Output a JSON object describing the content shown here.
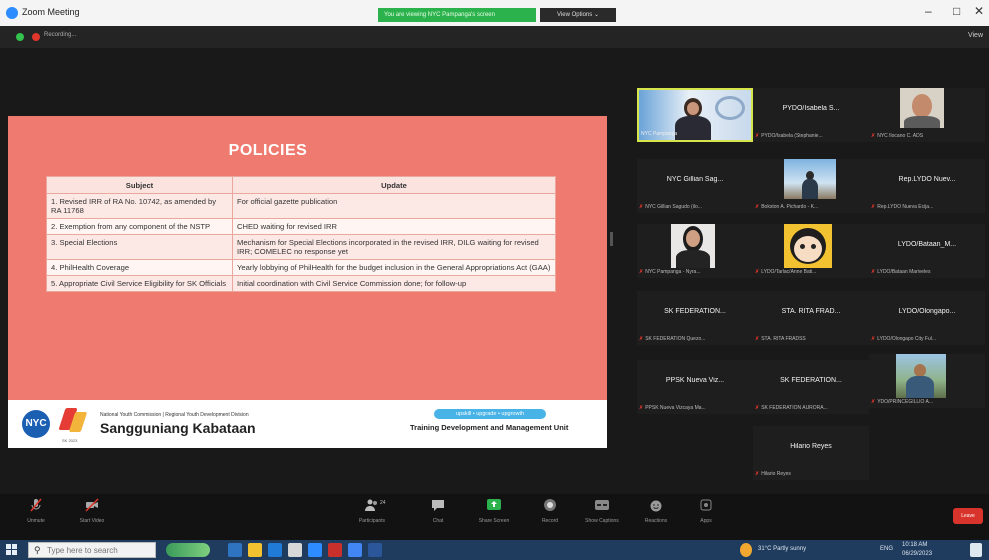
{
  "window": {
    "title": "Zoom Meeting",
    "share_banner": "You are viewing NYC Pampanga's screen",
    "view_options": "View Options ⌄",
    "minimize": "–",
    "maximize": "□",
    "close": "✕"
  },
  "status": {
    "recording": "Recording...",
    "view": "View"
  },
  "slide": {
    "title": "POLICIES",
    "table": {
      "headers": [
        "Subject",
        "Update"
      ],
      "rows": [
        {
          "subject": "1. Revised IRR of RA No. 10742, as amended by RA 11768",
          "update": "For official gazette publication"
        },
        {
          "subject": "2. Exemption from any component of the NSTP",
          "update": "CHED waiting for revised IRR"
        },
        {
          "subject": "3. Special Elections",
          "update": "Mechanism for Special Elections incorporated in the revised IRR, DILG waiting for revised IRR; COMELEC no response yet"
        },
        {
          "subject": "4. PhilHealth Coverage",
          "update": "Yearly lobbying of PhilHealth for the budget inclusion in the General Appropriations Act (GAA)"
        },
        {
          "subject": "5. Appropriate Civil Service Eligibility for SK Officials",
          "update": "Initial coordination with Civil Service Commission done; for follow-up"
        }
      ]
    },
    "footer": {
      "nyc_logo": "NYC",
      "sk_logo_sub": "SK 2023",
      "nyc_small": "National Youth Commission | Regional Youth Development Division",
      "sk_name": "Sangguniang Kabataan",
      "tagline": "upskill • upgrade • upgrowth",
      "unit": "Training Development and Management Unit"
    }
  },
  "participants": [
    {
      "display": "",
      "label": "NYC Pampanga",
      "muted": false,
      "video": true,
      "active": true
    },
    {
      "display": "PYDO/Isabela S...",
      "label": "PYDO/Isabela (Stephanie...",
      "muted": true,
      "video": false
    },
    {
      "display": "",
      "label": "NYC Ilocano C. ADS",
      "muted": true,
      "video": true
    },
    {
      "display": "NYC Gillian Sag...",
      "label": "NYC Gillian Sagudo (ilo...",
      "muted": true,
      "video": false
    },
    {
      "display": "",
      "label": "Bokston A. Pichardo - K...",
      "muted": true,
      "video": true
    },
    {
      "display": "Rep.LYDO Nuev...",
      "label": "Rep.LYDO Nueva Ecija...",
      "muted": true,
      "video": false
    },
    {
      "display": "",
      "label": "NYC Pampanga - Nyra...",
      "muted": true,
      "video": true
    },
    {
      "display": "",
      "label": "LYDO/Tarlac/Anne Bati...",
      "muted": true,
      "video": true
    },
    {
      "display": "LYDO/Bataan_M...",
      "label": "LYDO/Bataan Mariveles",
      "muted": true,
      "video": false
    },
    {
      "display": "SK FEDERATION...",
      "label": "SK FEDERATION Quezo...",
      "muted": true,
      "video": false
    },
    {
      "display": "STA. RITA FRAD...",
      "label": "STA. RITA FRADSS",
      "muted": true,
      "video": false
    },
    {
      "display": "LYDO/Olongapo...",
      "label": "LYDO/Olongapo City Ful...",
      "muted": true,
      "video": false
    },
    {
      "display": "PPSK Nueva Viz...",
      "label": "PPSK Nueva Vizcaya Ma...",
      "muted": true,
      "video": false
    },
    {
      "display": "SK FEDERATION...",
      "label": "SK FEDERATION AURORA...",
      "muted": true,
      "video": false
    },
    {
      "display": "",
      "label": "YDO/PRINCEGILLIO A...",
      "muted": true,
      "video": true
    },
    {
      "display": "Hilario Reyes",
      "label": "Hilario Reyes",
      "muted": true,
      "video": false
    }
  ],
  "controls": {
    "unmute": "Unmute",
    "start_video": "Start Video",
    "participants": "Participants",
    "participants_count": "24",
    "chat": "Chat",
    "share_screen": "Share Screen",
    "record": "Record",
    "show_captions": "Show Captions",
    "reactions": "Reactions",
    "apps": "Apps",
    "leave": "Leave"
  },
  "taskbar": {
    "search_placeholder": "Type here to search",
    "weather": "31°C Partly sunny",
    "lang": "ENG",
    "time": "10:18 AM",
    "date": "06/29/2023"
  },
  "colors": {
    "slide_bg": "#ef7a6f",
    "active_speaker_border": "#d6e64a",
    "muted_icon": "#e0362b",
    "share_banner": "#2bb24c",
    "leave_button": "#d9342b"
  }
}
